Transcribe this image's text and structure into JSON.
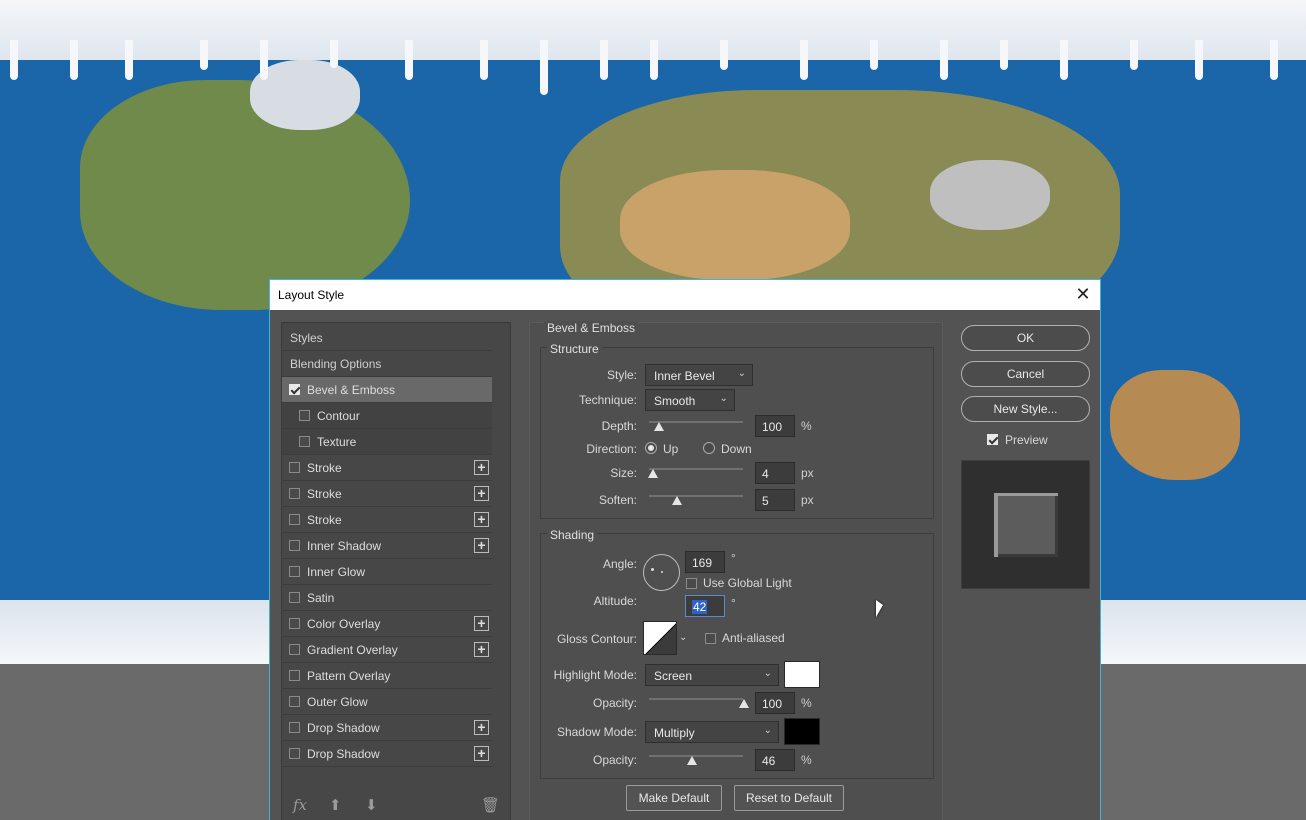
{
  "dialog": {
    "title": "Layout Style",
    "close_icon": "close-icon"
  },
  "left_panel": {
    "headers": [
      "Styles",
      "Blending Options"
    ],
    "items": [
      {
        "label": "Bevel & Emboss",
        "checked": true,
        "selected": true,
        "sub": false,
        "plus": false
      },
      {
        "label": "Contour",
        "checked": false,
        "selected": false,
        "sub": true,
        "plus": false
      },
      {
        "label": "Texture",
        "checked": false,
        "selected": false,
        "sub": true,
        "plus": false
      },
      {
        "label": "Stroke",
        "checked": false,
        "plus": true
      },
      {
        "label": "Stroke",
        "checked": false,
        "plus": true
      },
      {
        "label": "Stroke",
        "checked": false,
        "plus": true
      },
      {
        "label": "Inner Shadow",
        "checked": false,
        "plus": true
      },
      {
        "label": "Inner Glow",
        "checked": false,
        "plus": false
      },
      {
        "label": "Satin",
        "checked": false,
        "plus": false
      },
      {
        "label": "Color Overlay",
        "checked": false,
        "plus": true
      },
      {
        "label": "Gradient Overlay",
        "checked": false,
        "plus": true
      },
      {
        "label": "Pattern Overlay",
        "checked": false,
        "plus": false
      },
      {
        "label": "Outer Glow",
        "checked": false,
        "plus": false
      },
      {
        "label": "Drop Shadow",
        "checked": false,
        "plus": true
      },
      {
        "label": "Drop Shadow",
        "checked": false,
        "plus": true
      }
    ],
    "footer_icons": [
      "fx-icon",
      "move-up-icon",
      "move-down-icon",
      "trash-icon"
    ]
  },
  "bevel": {
    "title": "Bevel & Emboss",
    "structure": {
      "title": "Structure",
      "style_label": "Style:",
      "style_value": "Inner Bevel",
      "technique_label": "Technique:",
      "technique_value": "Smooth",
      "depth_label": "Depth:",
      "depth_value": "100",
      "depth_unit": "%",
      "direction_label": "Direction:",
      "dir_up": "Up",
      "dir_down": "Down",
      "size_label": "Size:",
      "size_value": "4",
      "size_unit": "px",
      "soften_label": "Soften:",
      "soften_value": "5",
      "soften_unit": "px"
    },
    "shading": {
      "title": "Shading",
      "angle_label": "Angle:",
      "angle_value": "169",
      "angle_unit": "°",
      "global_light": "Use Global Light",
      "altitude_label": "Altitude:",
      "altitude_value": "42",
      "altitude_unit": "°",
      "gloss_label": "Gloss Contour:",
      "anti_aliased": "Anti-aliased",
      "highlight_label": "Highlight Mode:",
      "highlight_value": "Screen",
      "opacity_label": "Opacity:",
      "highlight_opacity": "100",
      "pct": "%",
      "shadow_label": "Shadow Mode:",
      "shadow_value": "Multiply",
      "shadow_opacity": "46",
      "highlight_color": "#ffffff",
      "shadow_color": "#000000"
    },
    "make_default": "Make Default",
    "reset_default": "Reset to Default"
  },
  "right": {
    "ok": "OK",
    "cancel": "Cancel",
    "new_style": "New Style...",
    "preview": "Preview"
  }
}
